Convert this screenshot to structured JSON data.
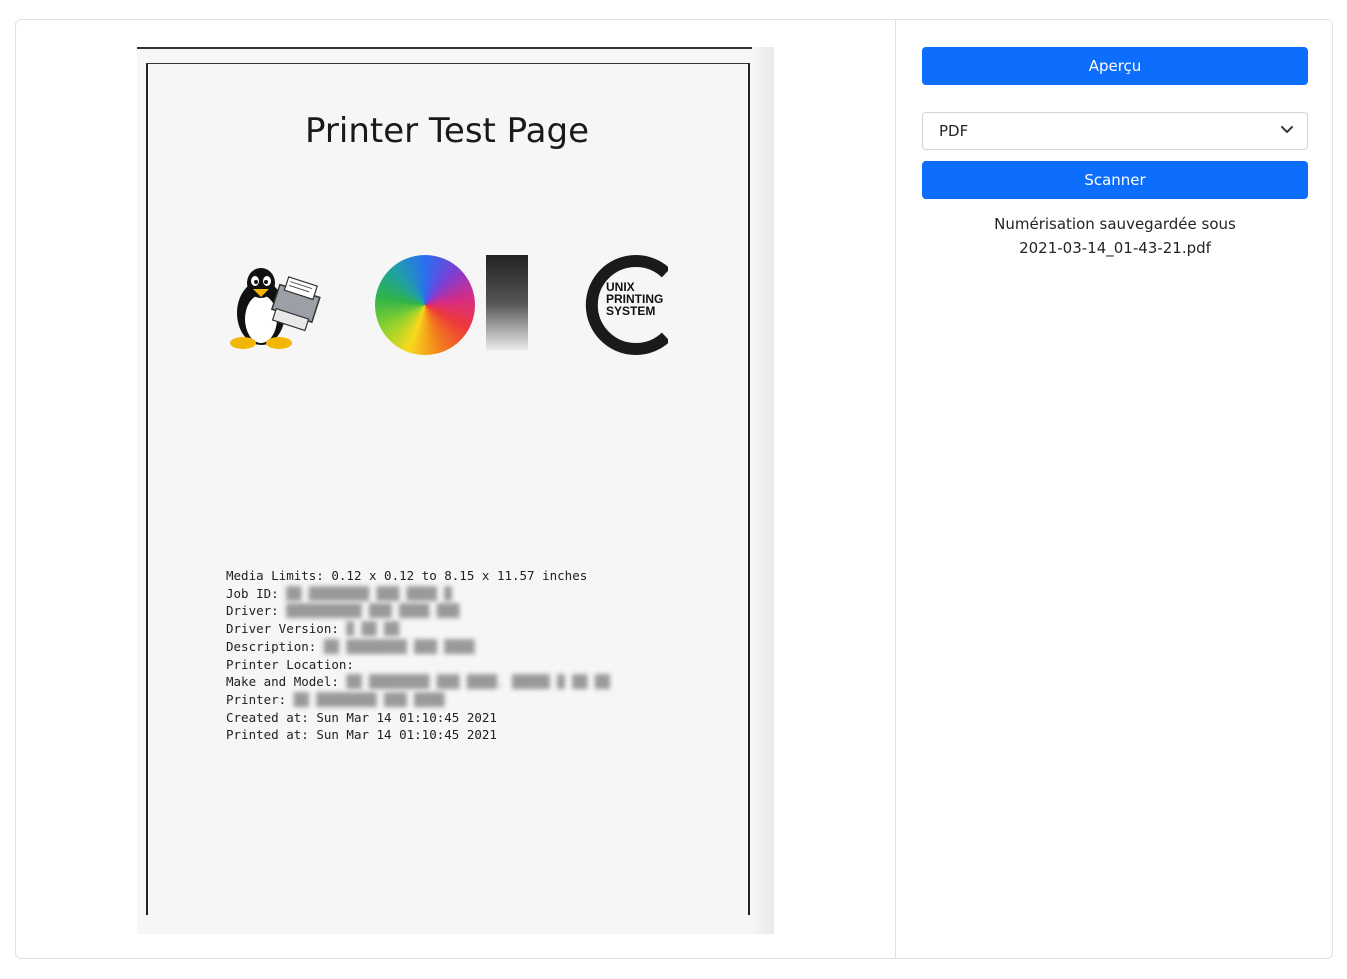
{
  "document": {
    "title": "Printer Test Page",
    "logo_text": "UNIX PRINTING SYSTEM",
    "info_lines": [
      {
        "label": "Media Limits:",
        "value": "0.12 x 0.12 to 8.15 x 11.57 inches",
        "blurred": false
      },
      {
        "label": "Job ID:",
        "value": "",
        "blurred": true
      },
      {
        "label": "Driver:",
        "value": "",
        "blurred": true
      },
      {
        "label": "Driver Version:",
        "value": "",
        "blurred": true
      },
      {
        "label": "Description:",
        "value": "",
        "blurred": true
      },
      {
        "label": "Printer Location:",
        "value": "",
        "blurred": false
      },
      {
        "label": "Make and Model:",
        "value": "",
        "blurred": true
      },
      {
        "label": "Printer:",
        "value": "",
        "blurred": true
      },
      {
        "label": "Created at:",
        "value": "Sun Mar 14 01:10:45 2021",
        "blurred": false
      },
      {
        "label": "Printed at:",
        "value": "Sun Mar 14 01:10:45 2021",
        "blurred": false
      }
    ]
  },
  "controls": {
    "preview_label": "Aperçu",
    "format_selected": "PDF",
    "scan_label": "Scanner",
    "status_line1": "Numérisation sauvegardée sous",
    "status_line2": "2021-03-14_01-43-21.pdf"
  },
  "colors": {
    "primary": "#0d6efd",
    "border": "#dee2e6"
  }
}
